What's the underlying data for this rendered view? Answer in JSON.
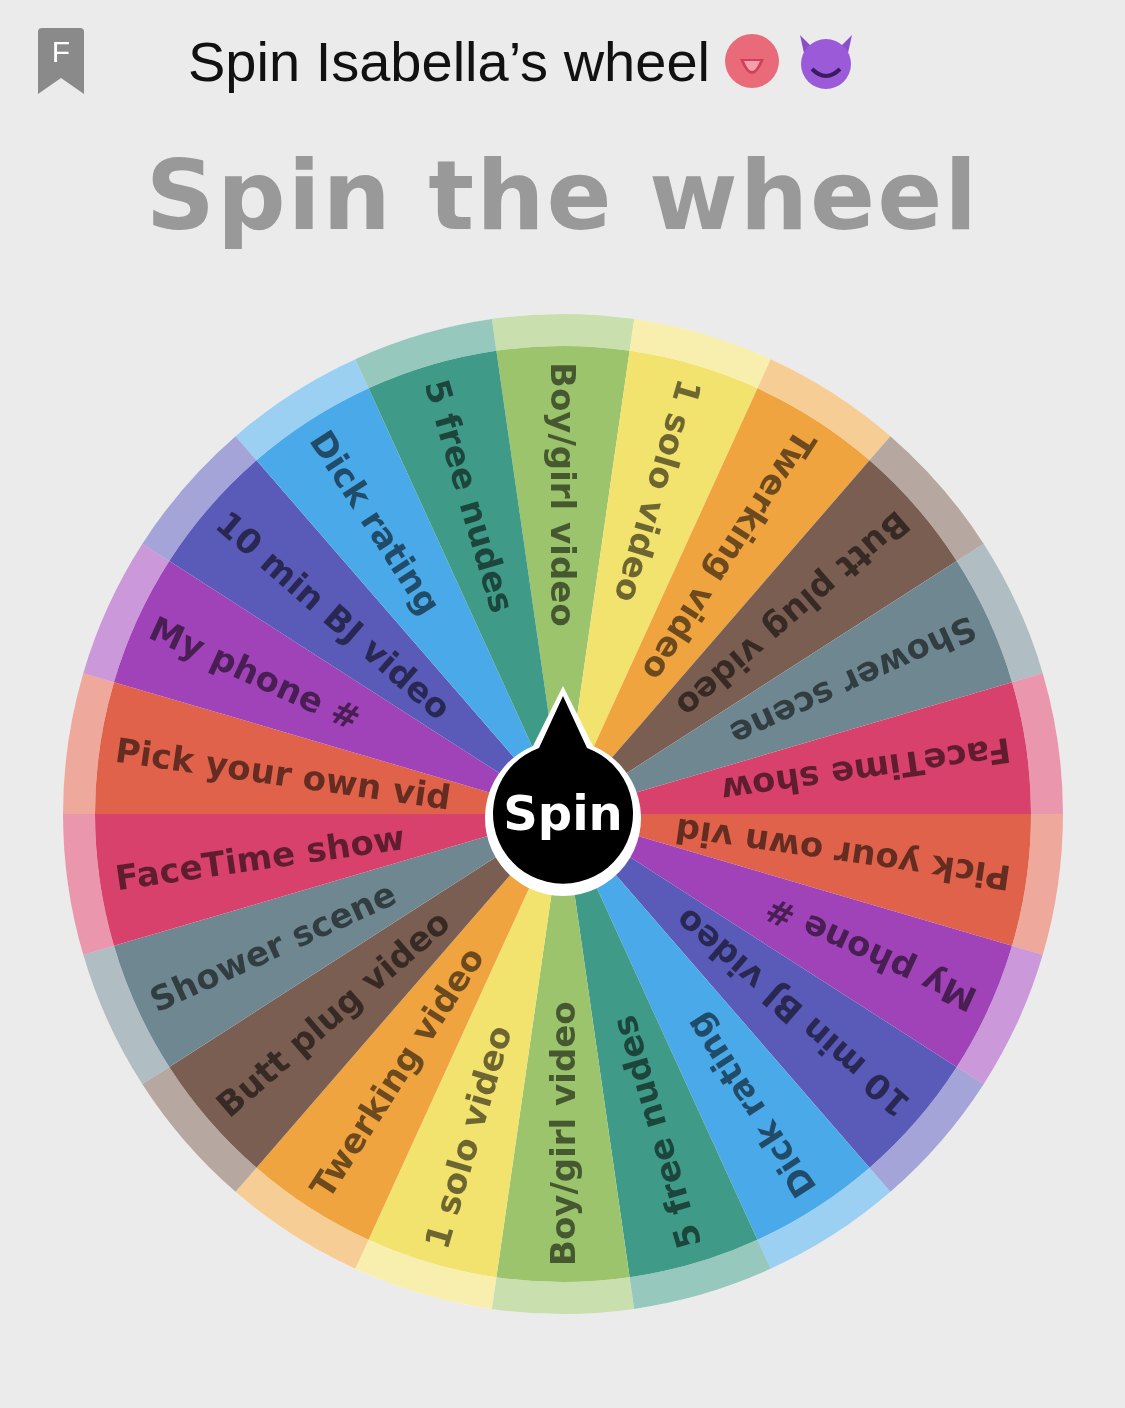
{
  "header": {
    "logo_letter": "F",
    "title": "Spin Isabella’s wheel"
  },
  "heading": "Spin the wheel",
  "wheel": {
    "button": "Spin",
    "segments": [
      {
        "label": "Boy/girl video",
        "color": "#9cc46c"
      },
      {
        "label": "1 solo video",
        "color": "#f2e26e"
      },
      {
        "label": "Twerking video",
        "color": "#f0a440"
      },
      {
        "label": "Butt plug video",
        "color": "#7a5e52"
      },
      {
        "label": "Shower scene",
        "color": "#6f8791"
      },
      {
        "label": "FaceTime show",
        "color": "#d8416b"
      },
      {
        "label": "Pick your own vid",
        "color": "#e0624b"
      },
      {
        "label": "My phone #",
        "color": "#a043b9"
      },
      {
        "label": "10 min BJ video",
        "color": "#5a5ab8"
      },
      {
        "label": "Dick rating",
        "color": "#4aa9e9"
      },
      {
        "label": "5 free nudes",
        "color": "#3f9b87"
      },
      {
        "label": "Boy/girl video",
        "color": "#9cc46c"
      },
      {
        "label": "1 solo video",
        "color": "#f2e26e"
      },
      {
        "label": "Twerking video",
        "color": "#f0a440"
      },
      {
        "label": "Butt plug video",
        "color": "#7a5e52"
      },
      {
        "label": "Shower scene",
        "color": "#6f8791"
      },
      {
        "label": "FaceTime show",
        "color": "#d8416b"
      },
      {
        "label": "Pick your own vid",
        "color": "#e0624b"
      },
      {
        "label": "My phone #",
        "color": "#a043b9"
      },
      {
        "label": "10 min BJ video",
        "color": "#5a5ab8"
      },
      {
        "label": "Dick rating",
        "color": "#4aa9e9"
      },
      {
        "label": "5 free nudes",
        "color": "#3f9b87"
      }
    ]
  }
}
